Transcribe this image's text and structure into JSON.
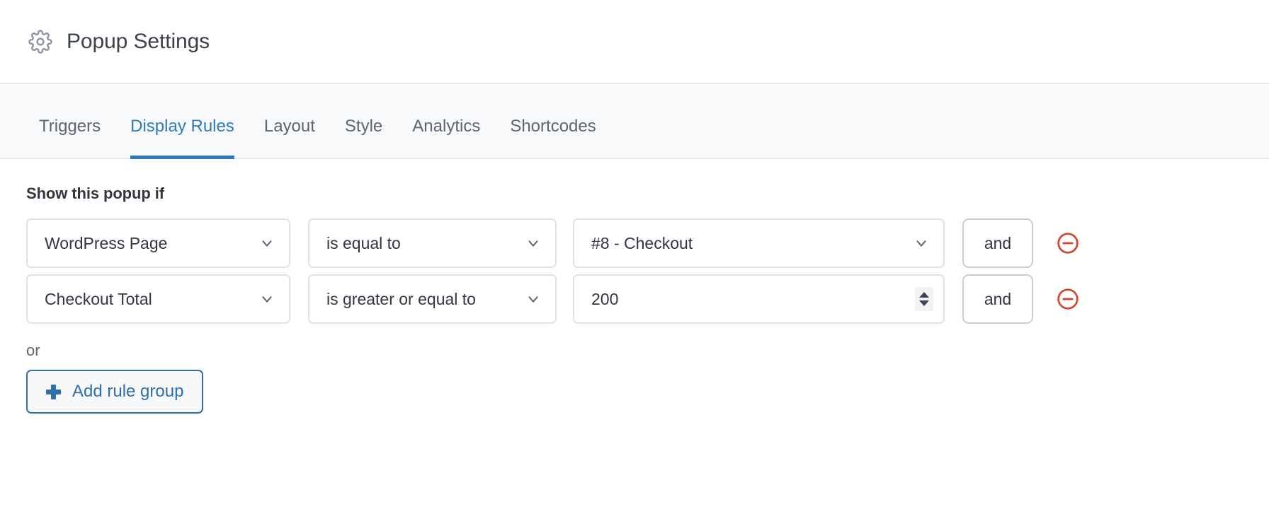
{
  "header": {
    "icon": "gear-icon",
    "title": "Popup Settings"
  },
  "tabs": [
    {
      "label": "Triggers",
      "active": false
    },
    {
      "label": "Display Rules",
      "active": true
    },
    {
      "label": "Layout",
      "active": false
    },
    {
      "label": "Style",
      "active": false
    },
    {
      "label": "Analytics",
      "active": false
    },
    {
      "label": "Shortcodes",
      "active": false
    }
  ],
  "rules_section": {
    "label": "Show this popup if",
    "or_label": "or",
    "add_group_label": "Add rule group",
    "add_group_icon": "plus-icon",
    "remove_icon": "circle-minus-icon",
    "chevron_icon": "chevron-down-icon",
    "spinner_icon": "number-stepper-icon",
    "rows": [
      {
        "subject": "WordPress Page",
        "operator": "is equal to",
        "value": "#8 - Checkout",
        "value_type": "select",
        "conjunction": "and"
      },
      {
        "subject": "Checkout Total",
        "operator": "is greater or equal to",
        "value": "200",
        "value_type": "number",
        "conjunction": "and"
      }
    ]
  },
  "colors": {
    "accent_blue": "#2f7bbd",
    "link_blue": "#2f6fab",
    "remove_red": "#d1462a",
    "tabbar_bg": "#f8f9fb",
    "border_gray": "#dfe3e9"
  }
}
